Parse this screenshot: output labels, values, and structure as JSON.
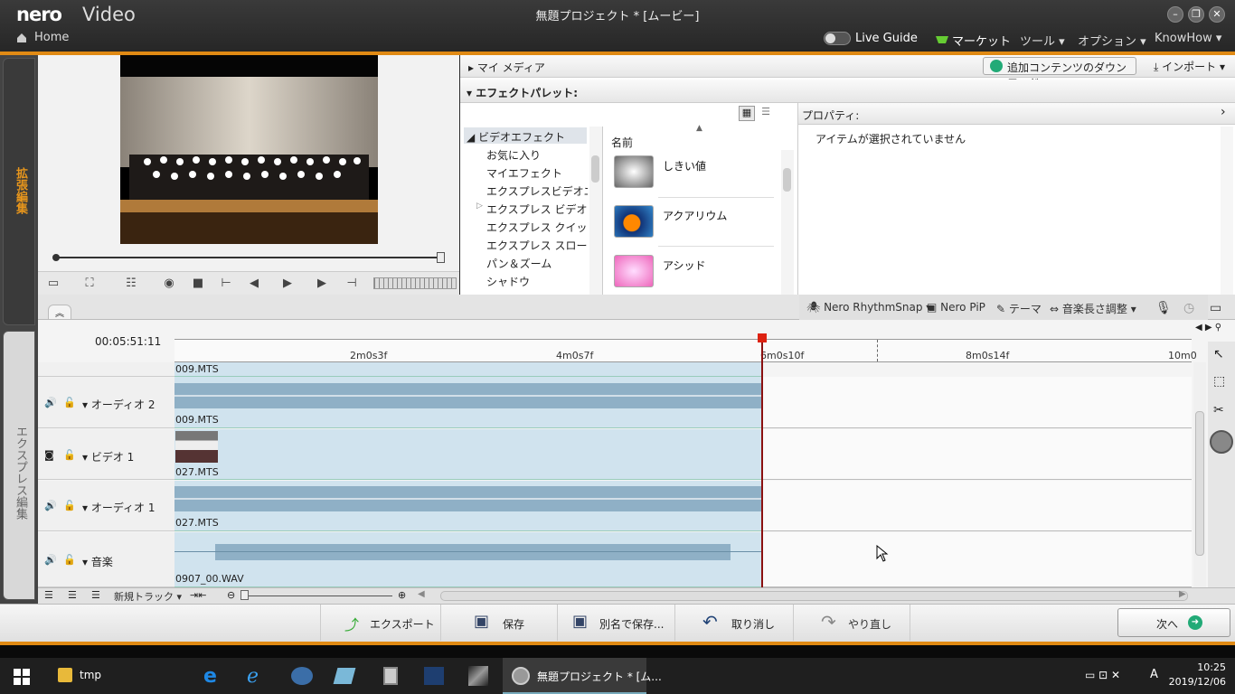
{
  "app": {
    "logo_nero": "nero",
    "logo_video": "Video",
    "window_title": "無題プロジェクト * [ムービー]"
  },
  "nav": {
    "home": "Home",
    "live_guide": "Live Guide",
    "market": "マーケット",
    "tools": "ツール ▾",
    "options": "オプション ▾",
    "knowhow": "KnowHow ▾"
  },
  "sidetabs": {
    "advanced": "拡張編集",
    "express": "エクスプレス編集"
  },
  "media": {
    "my_media": "マイ メディア",
    "download": "追加コンテンツのダウンロード",
    "import": "インポート ▾",
    "effect_palette": "エフェクトパレット:"
  },
  "tree": {
    "root": "ビデオエフェクト",
    "items": [
      "お気に入り",
      "マイエフェクト",
      "エクスプレスビデオエフェクト",
      "エクスプレス ビデオエフェクト",
      "エクスプレス クイックモーション",
      "エクスプレス スローモーション",
      "パン＆ズーム",
      "シャドウ"
    ]
  },
  "effects": {
    "column_name": "名前",
    "items": [
      "しきい値",
      "アクアリウム",
      "アシッド"
    ]
  },
  "properties": {
    "title": "プロパティ:",
    "empty": "アイテムが選択されていません"
  },
  "toolbar": {
    "rhythmsnap": "Nero RhythmSnap ▾",
    "pip": "Nero PiP",
    "theme": "テーマ",
    "music_fit": "音楽長さ調整 ▾"
  },
  "timeline": {
    "timecode": "00:05:51:11",
    "ticks": [
      "2m0s3f",
      "4m0s7f",
      "6m0s10f",
      "8m0s14f",
      "10m0"
    ],
    "tracks": [
      {
        "name": "オーディオ 2",
        "clip_top": "009.MTS",
        "clip_bottom": "009.MTS"
      },
      {
        "name": "ビデオ 1",
        "clip_bottom": "027.MTS"
      },
      {
        "name": "オーディオ 1",
        "clip_bottom": "027.MTS"
      },
      {
        "name": "音楽",
        "clip_bottom": "0907_00.WAV"
      }
    ],
    "new_track": "新規トラック ▾"
  },
  "actions": {
    "export": "エクスポート",
    "save": "保存",
    "save_as": "別名で保存...",
    "undo": "取り消し",
    "redo": "やり直し",
    "next": "次へ"
  },
  "taskbar": {
    "folder": "tmp",
    "active": "無題プロジェクト * [ム...",
    "time": "10:25",
    "date": "2019/12/06",
    "ime": "A"
  }
}
